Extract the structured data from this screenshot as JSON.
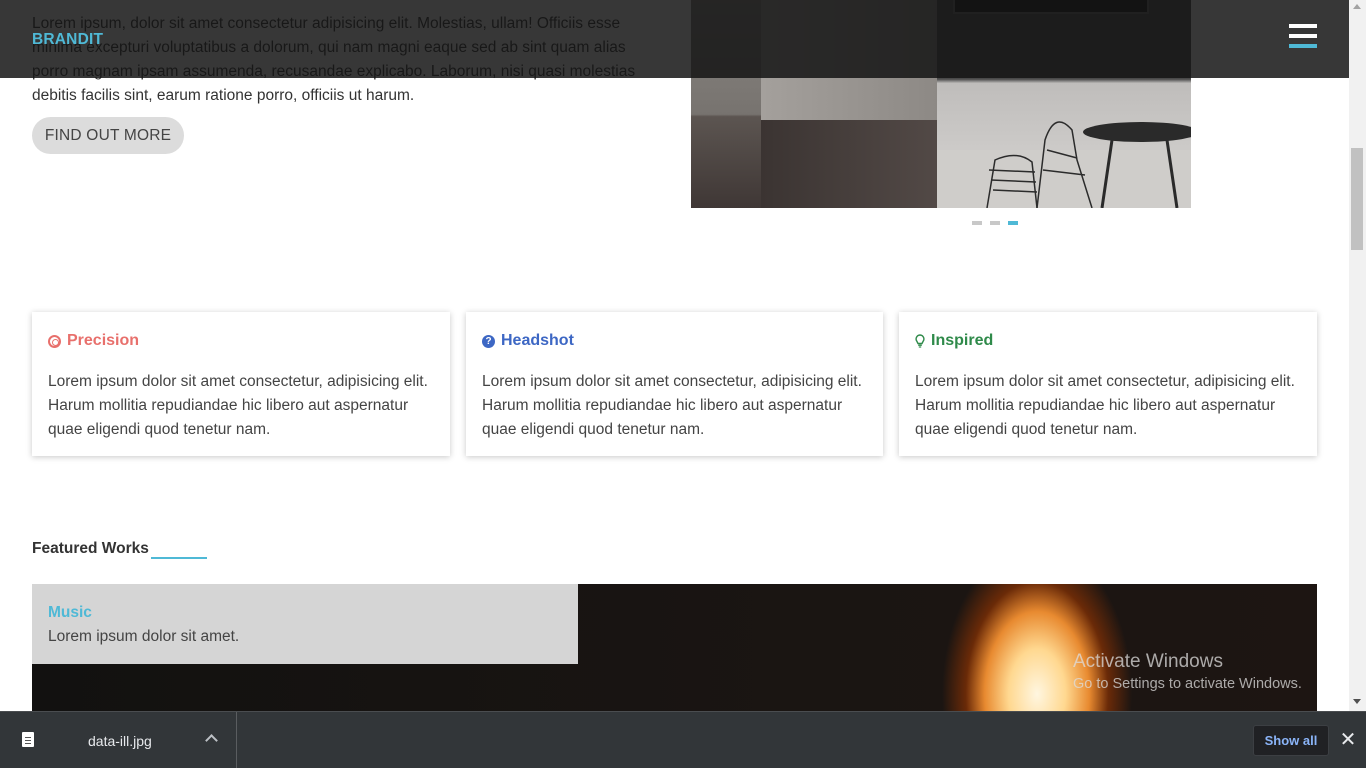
{
  "header": {
    "brand": "BRANDIT"
  },
  "hero": {
    "text": "Lorem ipsum, dolor sit amet consectetur adipisicing elit. Molestias, ullam! Officiis esse minima excepturi voluptatibus a dolorum, qui nam magni eaque sed ab sint quam alias porro magnam ipsam assumenda, recusandae explicabo. Laborum, nisi quasi molestias debitis facilis sint, earum ratione porro, officiis ut harum.",
    "button_label": "FIND OUT MORE",
    "carousel": {
      "slides": 3,
      "active_index": 2
    }
  },
  "cards": [
    {
      "title": "Precision",
      "icon": "target-icon",
      "color": "#e8706c",
      "text": "Lorem ipsum dolor sit amet consectetur, adipisicing elit. Harum mollitia repudiandae hic libero aut aspernatur quae eligendi quod tenetur nam."
    },
    {
      "title": "Headshot",
      "icon": "question-circle-icon",
      "color": "#3d67c4",
      "text": "Lorem ipsum dolor sit amet consectetur, adipisicing elit. Harum mollitia repudiandae hic libero aut aspernatur quae eligendi quod tenetur nam."
    },
    {
      "title": "Inspired",
      "icon": "lightbulb-icon",
      "color": "#2f8a4a",
      "text": "Lorem ipsum dolor sit amet consectetur, adipisicing elit. Harum mollitia repudiandae hic libero aut aspernatur quae eligendi quod tenetur nam."
    }
  ],
  "featured": {
    "title": "Featured Works",
    "works": [
      {
        "title": "Music",
        "desc": "Lorem ipsum dolor sit amet."
      }
    ]
  },
  "watermark": {
    "line1": "Activate Windows",
    "line2": "Go to Settings to activate Windows."
  },
  "download_bar": {
    "file_name": "data-ill.jpg",
    "show_all_label": "Show all",
    "close_glyph": "✕"
  },
  "colors": {
    "accent": "#4fb9d6",
    "navbar": "#141414"
  }
}
